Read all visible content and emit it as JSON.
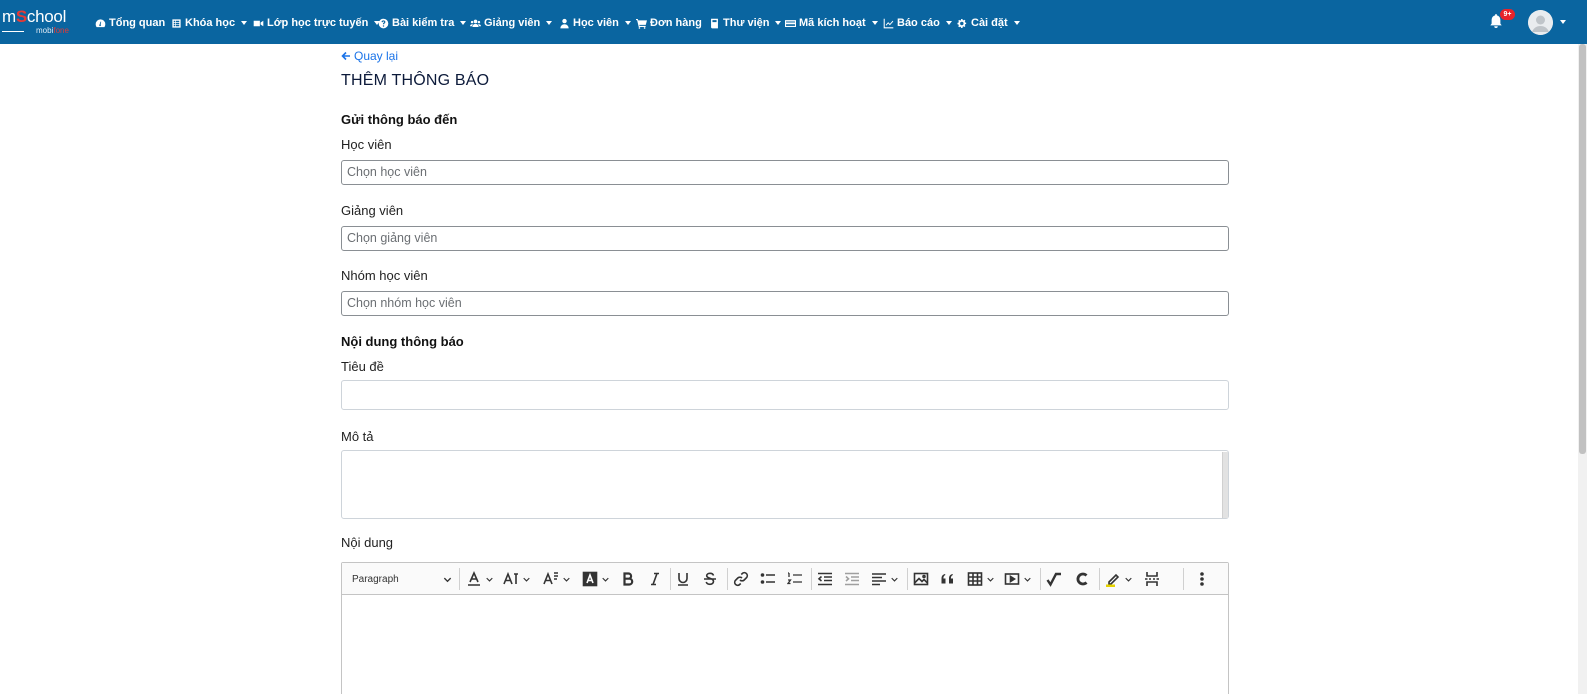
{
  "brand": {
    "logo_main_a": "m",
    "logo_main_o": "S",
    "logo_main_b": "chool",
    "logo_sub_a": "mobi",
    "logo_sub_b": "fone"
  },
  "nav": {
    "items": [
      {
        "label": "Tổng quan",
        "icon": "dashboard-icon",
        "dropdown": false
      },
      {
        "label": "Khóa học",
        "icon": "book-icon",
        "dropdown": true
      },
      {
        "label": "Lớp học trực tuyến",
        "icon": "video-icon",
        "dropdown": true
      },
      {
        "label": "Bài kiểm tra",
        "icon": "question-icon",
        "dropdown": true
      },
      {
        "label": "Giảng viên",
        "icon": "users-icon",
        "dropdown": true
      },
      {
        "label": "Học viên",
        "icon": "user-icon",
        "dropdown": true
      },
      {
        "label": "Đơn hàng",
        "icon": "cart-icon",
        "dropdown": false
      },
      {
        "label": "Thư viện",
        "icon": "library-icon",
        "dropdown": true
      },
      {
        "label": "Mã kích hoạt",
        "icon": "card-icon",
        "dropdown": true
      },
      {
        "label": "Báo cáo",
        "icon": "chart-icon",
        "dropdown": true
      },
      {
        "label": "Cài đặt",
        "icon": "cogs-icon",
        "dropdown": true
      }
    ],
    "notification_count": "9+"
  },
  "page": {
    "back_label": "Quay lại",
    "title": "THÊM THÔNG BÁO",
    "recipients_section": "Gửi thông báo đến",
    "students_label": "Học viên",
    "students_placeholder": "Chọn học viên",
    "teachers_label": "Giảng viên",
    "teachers_placeholder": "Chọn giảng viên",
    "groups_label": "Nhóm học viên",
    "groups_placeholder": "Chọn nhóm học viên",
    "content_section": "Nội dung thông báo",
    "title_label": "Tiêu đề",
    "title_value": "",
    "description_label": "Mô tả",
    "description_value": "",
    "body_label": "Nội dung"
  },
  "editor": {
    "paragraph_label": "Paragraph",
    "tools": [
      "font-color-icon",
      "font-size-icon",
      "font-family-icon",
      "font-background-icon",
      "bold-icon",
      "italic-icon",
      "underline-icon",
      "strikethrough-icon",
      "link-icon",
      "bulleted-list-icon",
      "numbered-list-icon",
      "outdent-icon",
      "indent-icon",
      "align-icon",
      "image-icon",
      "blockquote-icon",
      "table-icon",
      "media-icon",
      "math-icon",
      "chemistry-icon",
      "highlight-icon",
      "page-break-icon",
      "more-icon"
    ]
  },
  "colors": {
    "navbar": "#0a65a0",
    "link": "#1a73e8",
    "badge": "#e8232a"
  }
}
